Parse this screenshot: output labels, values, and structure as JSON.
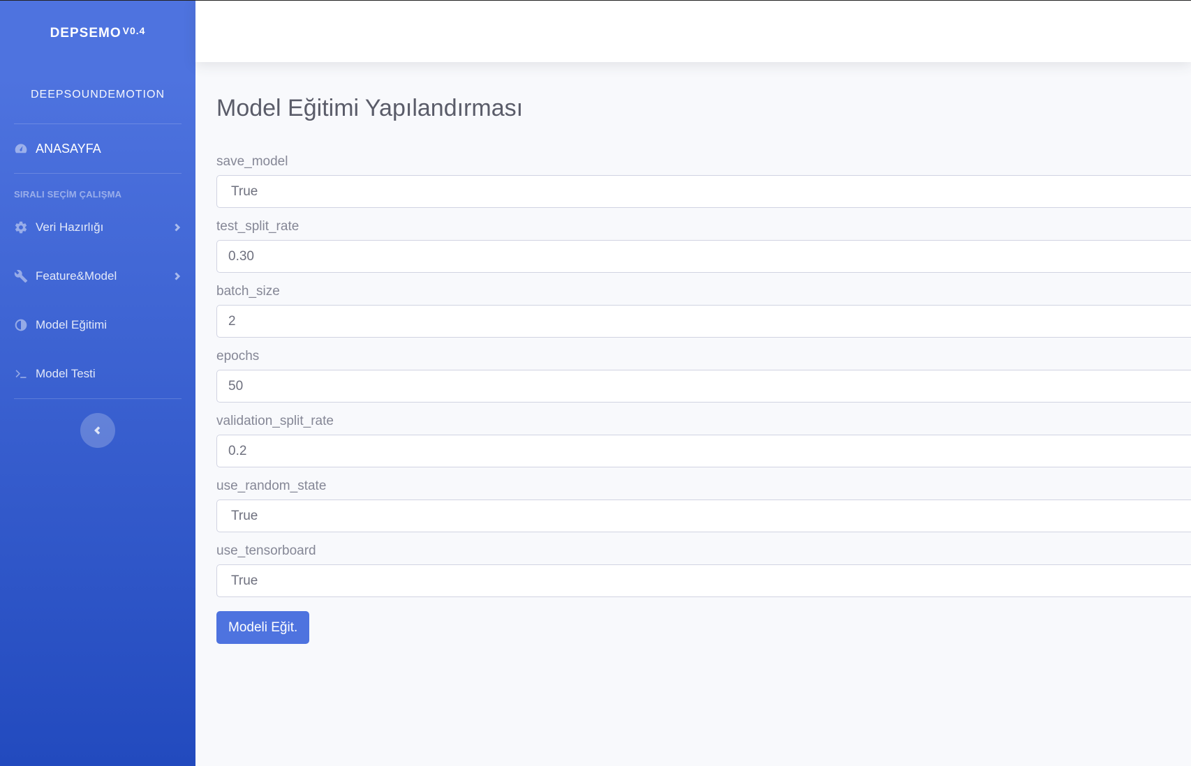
{
  "sidebar": {
    "brand": "DEPSEMO",
    "brand_version": "V0.4",
    "brand_subtitle": "DEEPSOUNDEMOTION",
    "home": {
      "label": "ANASAYFA",
      "icon": "tachometer-icon"
    },
    "section_heading": "SIRALI SEÇİM ÇALIŞMA",
    "items": [
      {
        "label": "Veri Hazırlığı",
        "icon": "gear-icon",
        "has_submenu": true
      },
      {
        "label": "Feature&Model",
        "icon": "wrench-icon",
        "has_submenu": true
      },
      {
        "label": "Model Eğitimi",
        "icon": "adjust-icon",
        "has_submenu": false
      },
      {
        "label": "Model Testi",
        "icon": "terminal-icon",
        "has_submenu": false
      }
    ],
    "toggle_icon": "chevron-left-icon"
  },
  "main": {
    "title": "Model Eğitimi Yapılandırması",
    "fields": [
      {
        "label": "save_model",
        "value": "True",
        "type": "select"
      },
      {
        "label": "test_split_rate",
        "value": "0.30",
        "type": "input"
      },
      {
        "label": "batch_size",
        "value": "2",
        "type": "input"
      },
      {
        "label": "epochs",
        "value": "50",
        "type": "input"
      },
      {
        "label": "validation_split_rate",
        "value": "0.2",
        "type": "input"
      },
      {
        "label": "use_random_state",
        "value": "True",
        "type": "select"
      },
      {
        "label": "use_tensorboard",
        "value": "True",
        "type": "select"
      }
    ],
    "submit_label": "Modeli Eğit."
  },
  "colors": {
    "primary": "#4e73df",
    "sidebar_gradient_end": "#224abe",
    "background": "#f8f9fc"
  }
}
